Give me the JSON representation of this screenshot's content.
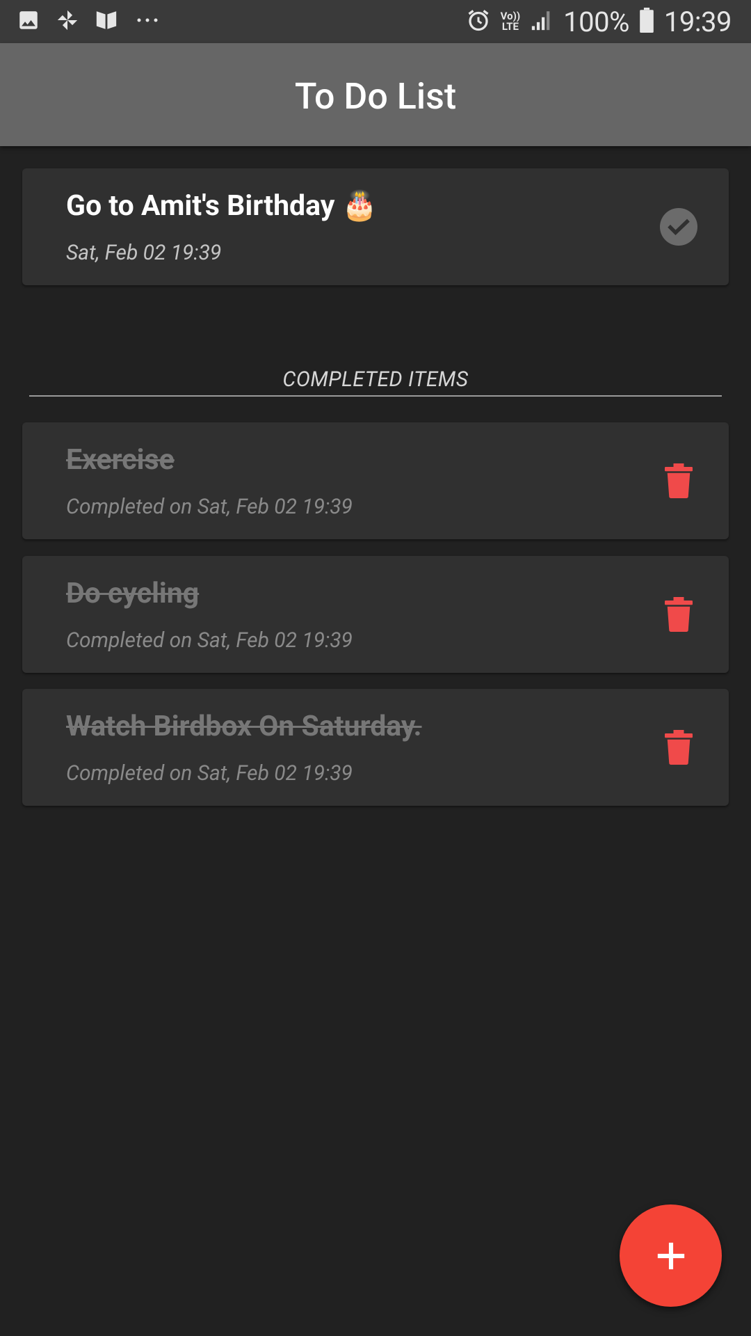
{
  "status_bar": {
    "battery_percent": "100%",
    "time": "19:39",
    "network_label_top": "Vo))",
    "network_label_bottom": "LTE",
    "icons": [
      "gallery-icon",
      "pinwheel-icon",
      "book-icon",
      "more-dots-icon",
      "alarm-icon",
      "signal-icon",
      "battery-icon"
    ]
  },
  "app_bar": {
    "title": "To Do List"
  },
  "active_items": [
    {
      "title": "Go to Amit's Birthday 🎂",
      "date": "Sat, Feb 02 19:39",
      "action_icon": "check-circle-icon"
    }
  ],
  "completed_section": {
    "label": "COMPLETED ITEMS"
  },
  "completed_items": [
    {
      "title": "Exercise",
      "subtitle": "Completed on Sat, Feb 02 19:39",
      "action_icon": "trash-icon"
    },
    {
      "title": "Do cycling",
      "subtitle": "Completed on Sat, Feb 02 19:39",
      "action_icon": "trash-icon"
    },
    {
      "title": "Watch Birdbox On Saturday.",
      "subtitle": "Completed on Sat, Feb 02 19:39",
      "action_icon": "trash-icon"
    }
  ],
  "fab": {
    "icon": "plus-icon"
  },
  "colors": {
    "background": "#212121",
    "app_bar": "#666666",
    "card": "#303030",
    "accent": "#f44336",
    "delete": "#f04a4a"
  }
}
